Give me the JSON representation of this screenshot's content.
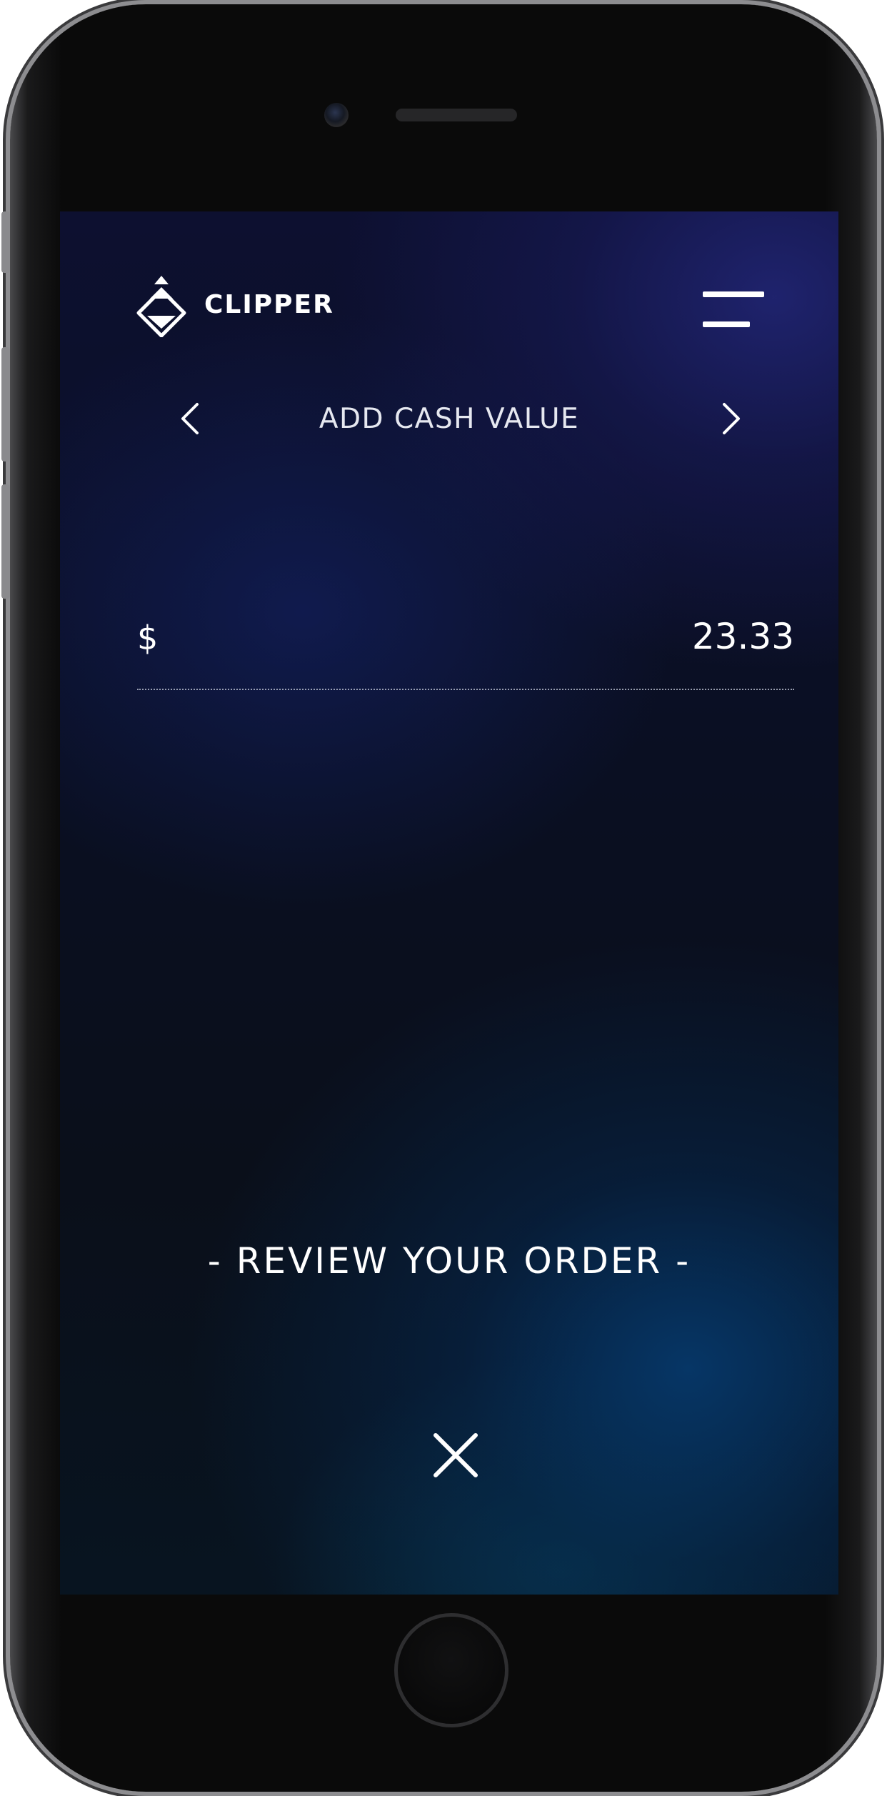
{
  "app": {
    "brand_name": "CLIPPER",
    "logo_icon": "clipper-diamond-logo-icon"
  },
  "header": {
    "menu_icon": "hamburger-menu-icon"
  },
  "nav": {
    "title": "ADD CASH VALUE",
    "prev_icon": "chevron-left-icon",
    "next_icon": "chevron-right-icon"
  },
  "amount": {
    "currency_symbol": "$",
    "value": "23.33"
  },
  "actions": {
    "review_label": "- REVIEW YOUR ORDER -",
    "close_icon": "close-icon"
  },
  "colors": {
    "text": "#ffffff",
    "background_top": "#1b1f5e",
    "background_bottom": "#063a5e"
  }
}
